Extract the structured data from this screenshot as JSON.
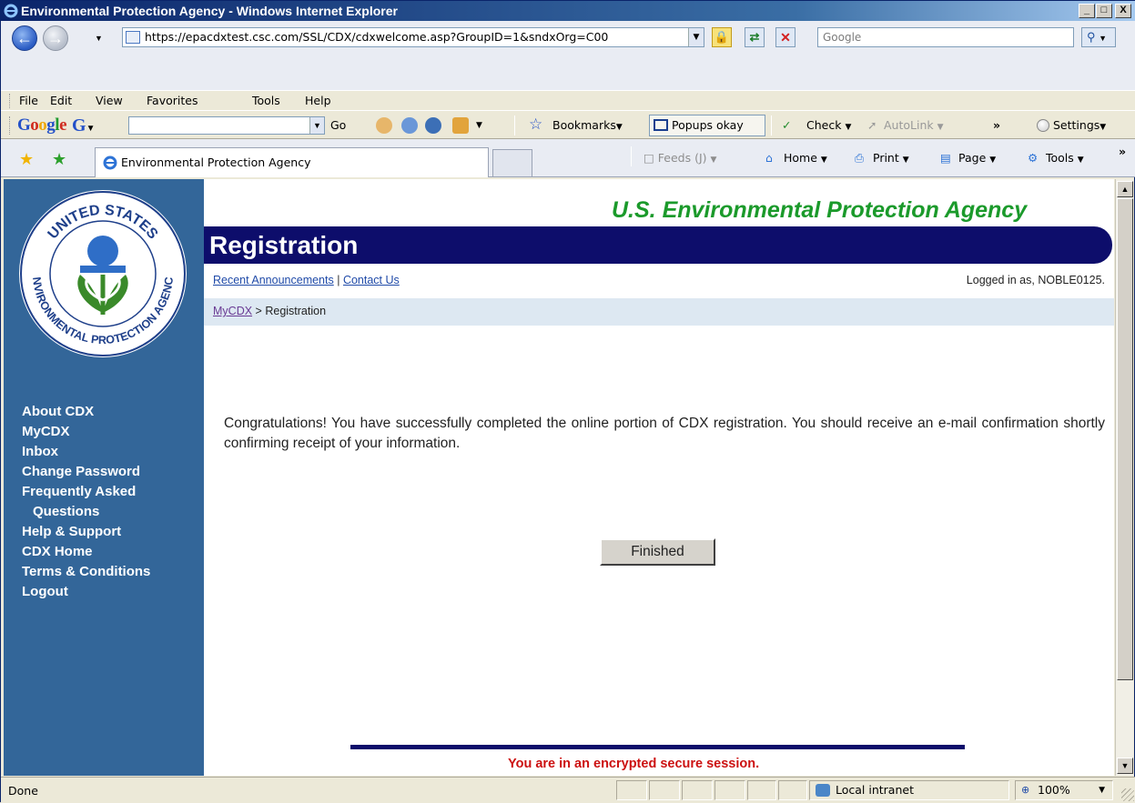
{
  "window": {
    "title": "Environmental Protection Agency - Windows Internet Explorer",
    "min_label": "_",
    "max_label": "□",
    "close_label": "X"
  },
  "address": {
    "url": "https://epacdxtest.csc.com/SSL/CDX/cdxwelcome.asp?GroupID=1&sndxOrg=C00",
    "search_placeholder": "Google"
  },
  "menu": [
    "File",
    "Edit",
    "View",
    "Favorites",
    "Tools",
    "Help"
  ],
  "google_toolbar": {
    "logo": "Google",
    "go_label": "Go",
    "bookmarks_label": "Bookmarks",
    "popups_label": "Popups okay",
    "check_label": "Check",
    "autolink_label": "AutoLink",
    "more_label": "»",
    "settings_label": "Settings"
  },
  "tabs": {
    "active_tab_label": "Environmental Protection Agency",
    "feeds_label": "Feeds (J)",
    "home_label": "Home",
    "print_label": "Print",
    "page_label": "Page",
    "tools_label": "Tools",
    "more_label": "»"
  },
  "page": {
    "agency_title": "U.S. Environmental Protection Agency",
    "banner_title": "Registration",
    "links": {
      "announcements": "Recent Announcements",
      "separator": "|",
      "contact": "Contact Us"
    },
    "logged_in": "Logged in as, NOBLE0125.",
    "breadcrumb": {
      "root": "MyCDX",
      "separator": ">",
      "current": "Registration"
    },
    "message": "Congratulations! You have successfully completed the online portion of CDX registration. You should receive an e-mail confirmation shortly confirming receipt of your information.",
    "finished_button": "Finished",
    "secure_notice": "You are in an encrypted secure session.",
    "seal": {
      "top_text": "UNITED STATES",
      "bottom_text": "ENVIRONMENTAL PROTECTION AGENCY"
    },
    "nav": [
      {
        "label": "About CDX",
        "indent": false
      },
      {
        "label": "MyCDX",
        "indent": false
      },
      {
        "label": "Inbox",
        "indent": false
      },
      {
        "label": "Change Password",
        "indent": false
      },
      {
        "label": "Frequently Asked",
        "indent": false
      },
      {
        "label": "Questions",
        "indent": true
      },
      {
        "label": "Help & Support",
        "indent": false
      },
      {
        "label": "CDX Home",
        "indent": false
      },
      {
        "label": "Terms & Conditions",
        "indent": false
      },
      {
        "label": "Logout",
        "indent": false
      }
    ]
  },
  "status": {
    "left_text": "Done",
    "zone": "Local intranet",
    "zoom": "100%"
  },
  "colors": {
    "nav_bg": "#336699",
    "banner_bg": "#0d0d6b",
    "agency_green": "#1b9a2b",
    "secure_red": "#cc1111"
  }
}
